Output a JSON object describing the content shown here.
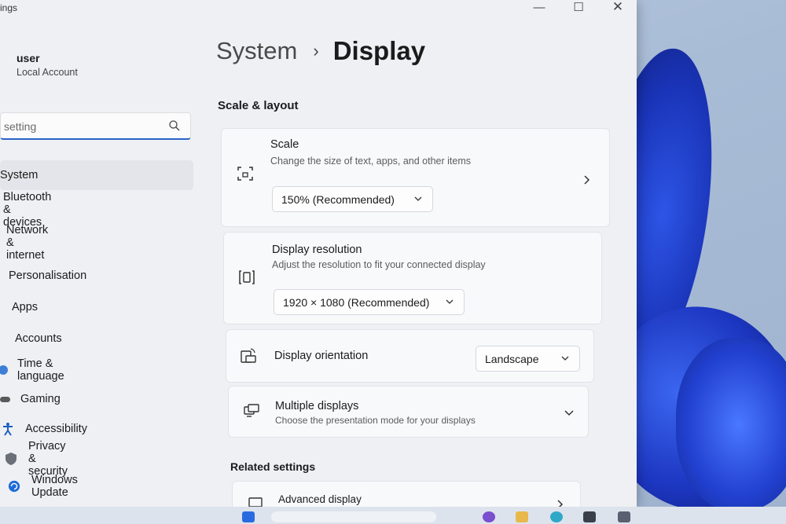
{
  "window": {
    "app_title": "ings",
    "controls": {
      "minimize": "—",
      "maximize": "☐",
      "close": "✕"
    }
  },
  "sidebar": {
    "user": {
      "name": "user",
      "account_type": "Local Account"
    },
    "search": {
      "placeholder": "setting"
    },
    "items": [
      {
        "label": "System",
        "icon": "laptop-icon",
        "active": true
      },
      {
        "label": "Bluetooth & devices",
        "icon": "bluetooth-icon"
      },
      {
        "label": "Network & internet",
        "icon": "wifi-icon"
      },
      {
        "label": "Personalisation",
        "icon": "brush-icon"
      },
      {
        "label": "Apps",
        "icon": "apps-icon"
      },
      {
        "label": "Accounts",
        "icon": "person-icon"
      },
      {
        "label": "Time & language",
        "icon": "globe-icon"
      },
      {
        "label": "Gaming",
        "icon": "gamepad-icon"
      },
      {
        "label": "Accessibility",
        "icon": "accessibility-icon"
      },
      {
        "label": "Privacy & security",
        "icon": "shield-icon"
      },
      {
        "label": "Windows Update",
        "icon": "update-icon"
      }
    ]
  },
  "main": {
    "breadcrumb": {
      "parent": "System",
      "separator": "›",
      "current": "Display"
    },
    "section_scale": "Scale & layout",
    "scale": {
      "title": "Scale",
      "description": "Change the size of text, apps, and other items",
      "value": "150% (Recommended)"
    },
    "resolution": {
      "title": "Display resolution",
      "description": "Adjust the resolution to fit your connected display",
      "value": "1920 × 1080 (Recommended)"
    },
    "orientation": {
      "title": "Display orientation",
      "value": "Landscape"
    },
    "multiple": {
      "title": "Multiple displays",
      "description": "Choose the presentation mode for your displays"
    },
    "section_related": "Related settings",
    "advanced": {
      "title": "Advanced display"
    }
  },
  "colors": {
    "accent": "#2b63c7",
    "window_bg": "#eef0f4",
    "card_bg": "#f8f9fb"
  }
}
